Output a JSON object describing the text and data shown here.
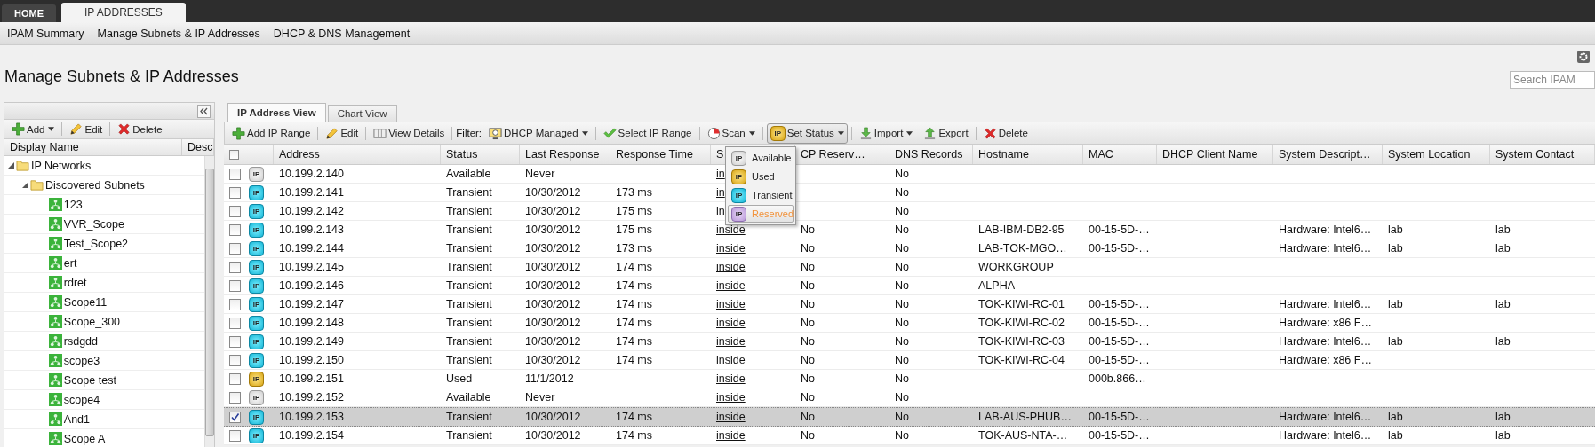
{
  "top_tabs": [
    {
      "label": "HOME",
      "selected": false
    },
    {
      "label": "IP ADDRESSES",
      "selected": true
    }
  ],
  "nav": [
    "IPAM Summary",
    "Manage Subnets & IP Addresses",
    "DHCP & DNS Management"
  ],
  "page_title": "Manage Subnets & IP Addresses",
  "search": {
    "placeholder": "Search IPAM"
  },
  "tree_panel": {
    "toolbar": {
      "add": "Add",
      "edit": "Edit",
      "delete": "Delete"
    },
    "columns": [
      "Display Name",
      "Desc"
    ],
    "nodes": [
      {
        "label": "IP Networks",
        "kind": "folder",
        "expanded": true,
        "children": [
          {
            "label": "Discovered Subnets",
            "kind": "folder",
            "expanded": true,
            "children": [
              {
                "label": "123",
                "kind": "subnet"
              },
              {
                "label": "VVR_Scope",
                "kind": "subnet"
              },
              {
                "label": "Test_Scope2",
                "kind": "subnet"
              },
              {
                "label": "ert",
                "kind": "subnet"
              },
              {
                "label": "rdret",
                "kind": "subnet"
              },
              {
                "label": "Scope11",
                "kind": "subnet"
              },
              {
                "label": "Scope_300",
                "kind": "subnet"
              },
              {
                "label": "rsdgdd",
                "kind": "subnet"
              },
              {
                "label": "scope3",
                "kind": "subnet"
              },
              {
                "label": "Scope test",
                "kind": "subnet"
              },
              {
                "label": "scope4",
                "kind": "subnet"
              },
              {
                "label": "And1",
                "kind": "subnet"
              },
              {
                "label": "Scope A",
                "kind": "subnet"
              }
            ]
          }
        ]
      }
    ]
  },
  "view_tabs": [
    {
      "label": "IP Address View",
      "selected": true
    },
    {
      "label": "Chart View",
      "selected": false
    }
  ],
  "toolbar": {
    "add_ip_range": "Add IP Range",
    "edit": "Edit",
    "view_details": "View Details",
    "filter_label": "Filter:",
    "dhcp_managed": "DHCP Managed",
    "select_ip_range": "Select IP Range",
    "scan": "Scan",
    "set_status": {
      "label": "Set Status",
      "badge": "IP",
      "open": true
    },
    "import": "Import",
    "export": "Export",
    "delete": "Delete"
  },
  "status_menu": [
    {
      "label": "Available",
      "badge": "IP",
      "kind": "available",
      "selected": false
    },
    {
      "label": "Used",
      "badge": "IP",
      "kind": "used",
      "selected": false
    },
    {
      "label": "Transient",
      "badge": "IP",
      "kind": "transient",
      "selected": false
    },
    {
      "label": "Reserved",
      "badge": "IP",
      "kind": "reserved",
      "selected": true
    }
  ],
  "table": {
    "select_all_checked": false,
    "columns": [
      "Address",
      "Status",
      "Last Response",
      "Response Time",
      "S",
      "CP Reserv…",
      "DNS Records",
      "Hostname",
      "MAC",
      "DHCP Client Name",
      "System Descript…",
      "System Location",
      "System Contact"
    ],
    "rows": [
      {
        "checked": false,
        "selected": false,
        "kind": "available",
        "badge": "IP",
        "address": "10.199.2.140",
        "status": "Available",
        "last_response": "Never",
        "column_7": "in",
        "dns_records": "No"
      },
      {
        "checked": false,
        "selected": false,
        "kind": "transient",
        "badge": "IP",
        "address": "10.199.2.141",
        "status": "Transient",
        "last_response": "10/30/2012",
        "response_time": "173 ms",
        "column_7": "in",
        "dns_records": "No"
      },
      {
        "checked": false,
        "selected": false,
        "kind": "transient",
        "badge": "IP",
        "address": "10.199.2.142",
        "status": "Transient",
        "last_response": "10/30/2012",
        "response_time": "175 ms",
        "column_7": "in",
        "dns_records": "No"
      },
      {
        "checked": false,
        "selected": false,
        "kind": "transient",
        "badge": "IP",
        "address": "10.199.2.143",
        "status": "Transient",
        "last_response": "10/30/2012",
        "response_time": "175 ms",
        "column_7": "inside",
        "dhcp_reservation": "No",
        "dns_records": "No",
        "hostname": "LAB-IBM-DB2-95",
        "mac": "00-15-5D-…",
        "system_description": "Hardware: Intel6…",
        "system_location": "lab",
        "system_contact": "lab"
      },
      {
        "checked": false,
        "selected": false,
        "kind": "transient",
        "badge": "IP",
        "address": "10.199.2.144",
        "status": "Transient",
        "last_response": "10/30/2012",
        "response_time": "173 ms",
        "column_7": "inside",
        "dhcp_reservation": "No",
        "dns_records": "No",
        "hostname": "LAB-TOK-MGO…",
        "mac": "00-15-5D-…",
        "system_description": "Hardware: Intel6…",
        "system_location": "lab",
        "system_contact": "lab"
      },
      {
        "checked": false,
        "selected": false,
        "kind": "transient",
        "badge": "IP",
        "address": "10.199.2.145",
        "status": "Transient",
        "last_response": "10/30/2012",
        "response_time": "174 ms",
        "column_7": "inside",
        "dhcp_reservation": "No",
        "dns_records": "No",
        "hostname": "WORKGROUP"
      },
      {
        "checked": false,
        "selected": false,
        "kind": "transient",
        "badge": "IP",
        "address": "10.199.2.146",
        "status": "Transient",
        "last_response": "10/30/2012",
        "response_time": "174 ms",
        "column_7": "inside",
        "dhcp_reservation": "No",
        "dns_records": "No",
        "hostname": "ALPHA"
      },
      {
        "checked": false,
        "selected": false,
        "kind": "transient",
        "badge": "IP",
        "address": "10.199.2.147",
        "status": "Transient",
        "last_response": "10/30/2012",
        "response_time": "174 ms",
        "column_7": "inside",
        "dhcp_reservation": "No",
        "dns_records": "No",
        "hostname": "TOK-KIWI-RC-01",
        "mac": "00-15-5D-…",
        "system_description": "Hardware: Intel6…",
        "system_location": "lab",
        "system_contact": "lab"
      },
      {
        "checked": false,
        "selected": false,
        "kind": "transient",
        "badge": "IP",
        "address": "10.199.2.148",
        "status": "Transient",
        "last_response": "10/30/2012",
        "response_time": "174 ms",
        "column_7": "inside",
        "dhcp_reservation": "No",
        "dns_records": "No",
        "hostname": "TOK-KIWI-RC-02",
        "mac": "00-15-5D-…",
        "system_description": "Hardware: x86 F…"
      },
      {
        "checked": false,
        "selected": false,
        "kind": "transient",
        "badge": "IP",
        "address": "10.199.2.149",
        "status": "Transient",
        "last_response": "10/30/2012",
        "response_time": "174 ms",
        "column_7": "inside",
        "dhcp_reservation": "No",
        "dns_records": "No",
        "hostname": "TOK-KIWI-RC-03",
        "mac": "00-15-5D-…",
        "system_description": "Hardware: Intel6…",
        "system_location": "lab",
        "system_contact": "lab"
      },
      {
        "checked": false,
        "selected": false,
        "kind": "transient",
        "badge": "IP",
        "address": "10.199.2.150",
        "status": "Transient",
        "last_response": "10/30/2012",
        "response_time": "174 ms",
        "column_7": "inside",
        "dhcp_reservation": "No",
        "dns_records": "No",
        "hostname": "TOK-KIWI-RC-04",
        "mac": "00-15-5D-…",
        "system_description": "Hardware: x86 F…"
      },
      {
        "checked": false,
        "selected": false,
        "kind": "used",
        "badge": "IP",
        "address": "10.199.2.151",
        "status": "Used",
        "last_response": "11/1/2012",
        "column_7": "inside",
        "dhcp_reservation": "No",
        "dns_records": "No",
        "mac": "000b.866…"
      },
      {
        "checked": false,
        "selected": false,
        "kind": "available",
        "badge": "IP",
        "address": "10.199.2.152",
        "status": "Available",
        "last_response": "Never",
        "column_7": "inside",
        "dhcp_reservation": "No",
        "dns_records": "No"
      },
      {
        "checked": true,
        "selected": true,
        "kind": "transient",
        "badge": "IP",
        "address": "10.199.2.153",
        "status": "Transient",
        "last_response": "10/30/2012",
        "response_time": "174 ms",
        "column_7": "inside",
        "dhcp_reservation": "No",
        "dns_records": "No",
        "hostname": "LAB-AUS-PHUB…",
        "mac": "00-15-5D-…",
        "system_description": "Hardware: Intel6…",
        "system_location": "lab",
        "system_contact": "lab"
      },
      {
        "checked": false,
        "selected": false,
        "kind": "transient",
        "badge": "IP",
        "address": "10.199.2.154",
        "status": "Transient",
        "last_response": "10/30/2012",
        "response_time": "174 ms",
        "column_7": "inside",
        "dhcp_reservation": "No",
        "dns_records": "No",
        "hostname": "TOK-AUS-NTA-…",
        "mac": "00-15-5D-…",
        "system_description": "Hardware: Intel6…",
        "system_location": "lab",
        "system_contact": "lab"
      }
    ]
  }
}
